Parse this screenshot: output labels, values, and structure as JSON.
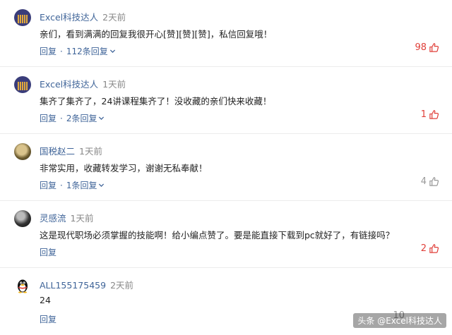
{
  "comments": [
    {
      "user": "Excel科技达人",
      "time": "2天前",
      "text": "亲们，看到满满的回复我很开心[赞][赞][赞]，私信回复哦！",
      "reply_label": "回复",
      "sep": "·",
      "replies_label": "112条回复",
      "likes": "98",
      "liked": true
    },
    {
      "user": "Excel科技达人",
      "time": "1天前",
      "text": "集齐了集齐了，24讲课程集齐了！没收藏的亲们快来收藏！",
      "reply_label": "回复",
      "sep": "·",
      "replies_label": "2条回复",
      "likes": "1",
      "liked": true
    },
    {
      "user": "国税赵二",
      "time": "1天前",
      "text": "非常实用，收藏转发学习，谢谢无私奉献！",
      "reply_label": "回复",
      "sep": "·",
      "replies_label": "1条回复",
      "likes": "4",
      "liked": false
    },
    {
      "user": "灵感流",
      "time": "1天前",
      "text": "这是现代职场必须掌握的技能啊！给小编点赞了。要是能直接下载到pc就好了，有链接吗？",
      "reply_label": "回复",
      "likes": "2",
      "liked": true
    },
    {
      "user": "ALL155175459",
      "time": "2天前",
      "text": "24",
      "reply_label": "回复",
      "likes": "10"
    }
  ],
  "watermark": "头条 @Excel科技达人",
  "colors": {
    "link": "#406599",
    "like_active": "#e0403a",
    "like_inactive": "#999999"
  }
}
